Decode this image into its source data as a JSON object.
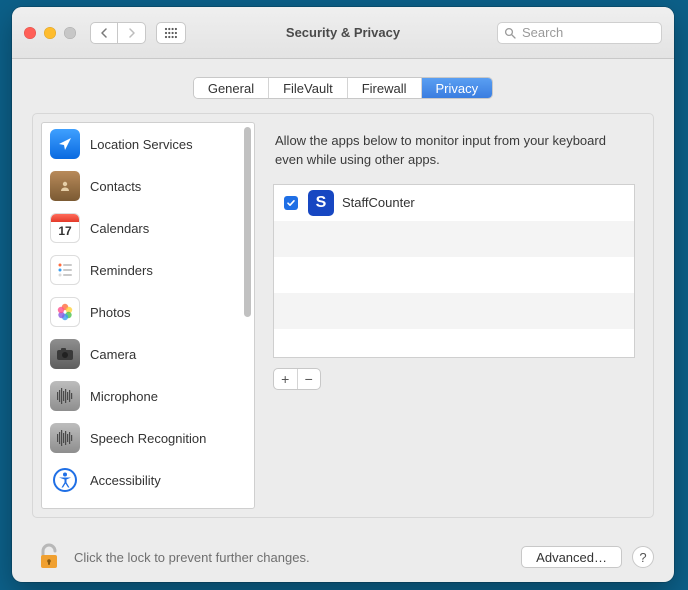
{
  "window": {
    "title": "Security & Privacy"
  },
  "search": {
    "placeholder": "Search"
  },
  "tabs": [
    {
      "label": "General"
    },
    {
      "label": "FileVault"
    },
    {
      "label": "Firewall"
    },
    {
      "label": "Privacy"
    }
  ],
  "active_tab_label": "Privacy",
  "sidebar": {
    "items": [
      {
        "label": "Location Services"
      },
      {
        "label": "Contacts"
      },
      {
        "label": "Calendars",
        "day": "17"
      },
      {
        "label": "Reminders"
      },
      {
        "label": "Photos"
      },
      {
        "label": "Camera"
      },
      {
        "label": "Microphone"
      },
      {
        "label": "Speech Recognition"
      },
      {
        "label": "Accessibility"
      }
    ]
  },
  "main": {
    "description": "Allow the apps below to monitor input from your keyboard even while using other apps.",
    "apps": [
      {
        "name": "StaffCounter",
        "checked": true,
        "icon_letter": "S"
      }
    ],
    "add_label": "+",
    "remove_label": "−"
  },
  "footer": {
    "lock_text": "Click the lock to prevent further changes.",
    "advanced_label": "Advanced…",
    "help_label": "?"
  }
}
